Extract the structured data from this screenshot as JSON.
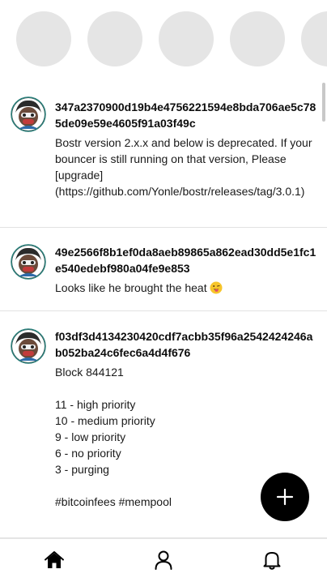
{
  "stories": [
    {
      "icon": "story-placeholder"
    },
    {
      "icon": "story-placeholder"
    },
    {
      "icon": "story-placeholder"
    },
    {
      "icon": "story-placeholder"
    },
    {
      "icon": "story-placeholder"
    }
  ],
  "posts": [
    {
      "author": "347a2370900d19b4e4756221594e8bda706ae5c785de09e59e4605f91a03f49c",
      "text": "Bostr version 2.x.x and below is deprecated. If your bouncer is still running on that version, Please [upgrade](https://github.com/Yonle/bostr/releases/tag/3.0.1)"
    },
    {
      "author": "49e2566f8b1ef0da8aeb89865a862ead30dd5e1fc1e540edebf980a04fe9e853",
      "text": "Looks like he brought the heat",
      "emoji": "tongue-wink-emoji"
    },
    {
      "author": "f03df3d4134230420cdf7acbb35f96a2542424246ab052ba24c6fec6a4d4f676",
      "text": "Block 844121\n\n11 - high priority\n10 - medium priority\n9 - low priority\n6 - no priority\n3 - purging\n\n#bitcoinfees #mempool"
    }
  ],
  "fab": {
    "icon": "plus-icon"
  },
  "nav": [
    {
      "icon": "home-icon"
    },
    {
      "icon": "profile-icon"
    },
    {
      "icon": "bell-icon"
    }
  ],
  "colors": {
    "accent": "#000000",
    "placeholder": "#e5e5e5",
    "divider": "#e2e2e2"
  }
}
